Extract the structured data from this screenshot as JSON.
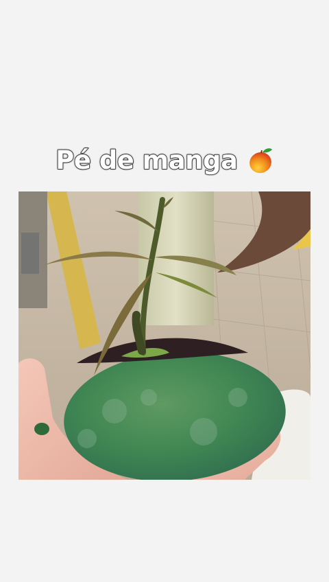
{
  "post": {
    "caption": "Pé de manga"
  },
  "icons": {
    "caption_emoji": "mango-emoji"
  }
}
